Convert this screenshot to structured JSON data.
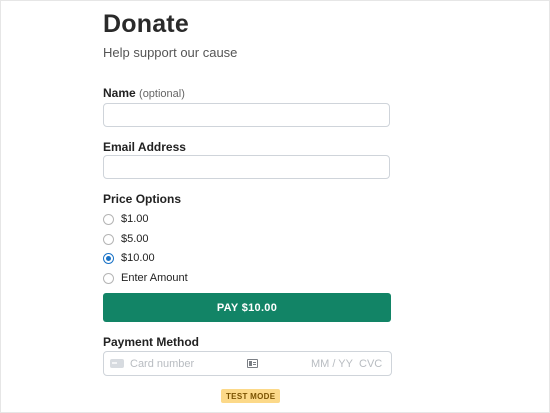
{
  "form": {
    "title": "Donate",
    "subtitle": "Help support our cause"
  },
  "name_field": {
    "label": "Name",
    "hint": "(optional)",
    "value": ""
  },
  "email_field": {
    "label": "Email Address",
    "value": ""
  },
  "price_options": {
    "label": "Price Options",
    "options": [
      {
        "label": "$1.00",
        "selected": false
      },
      {
        "label": "$5.00",
        "selected": false
      },
      {
        "label": "$10.00",
        "selected": true
      },
      {
        "label": "Enter Amount",
        "selected": false
      }
    ]
  },
  "pay_button": {
    "label": "PAY $10.00",
    "color": "#128466"
  },
  "payment_method": {
    "label": "Payment Method",
    "card_number_placeholder": "Card number",
    "expiry_placeholder": "MM / YY",
    "cvc_placeholder": "CVC",
    "card_icon": "credit-card-icon",
    "autofill_icon": "contact-card-icon"
  },
  "badge": {
    "label": "TEST MODE",
    "color": "#fcd989"
  }
}
